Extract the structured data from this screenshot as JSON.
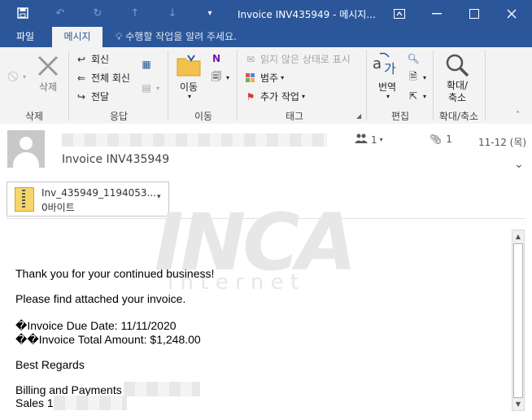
{
  "titlebar": {
    "title": "Invoice INV435949 - 메시지...",
    "save_icon": "save-icon",
    "undo_icon": "undo-icon",
    "redo_icon": "redo-icon",
    "up_icon": "up-arrow-icon",
    "down_icon": "down-arrow-icon",
    "customize_icon": "customize-toolbar-icon"
  },
  "tabs": {
    "file": "파일",
    "message": "메시지",
    "tell_me": "수행할 작업을 알려 주세요."
  },
  "ribbon": {
    "delete_group": {
      "label": "삭제",
      "delete": "삭제"
    },
    "respond_group": {
      "label": "응답",
      "reply": "회신",
      "reply_all": "전체 회신",
      "forward": "전달"
    },
    "move_group": {
      "label": "이동",
      "move": "이동"
    },
    "tags_group": {
      "label": "태그",
      "mark_unread": "읽지 않은 상태로 표시",
      "categorize": "범주",
      "follow_up": "추가 작업"
    },
    "editing_group": {
      "label": "편집",
      "translate": "번역"
    },
    "zoom_group": {
      "label": "확대/축소",
      "zoom": "확대/\n축소"
    }
  },
  "header": {
    "subject": "Invoice INV435949",
    "people_count": "1",
    "attachment_count": "1",
    "date": "11-12 (목)"
  },
  "attachment": {
    "name": "Inv_435949_1194053...",
    "size": "0바이트"
  },
  "watermark": {
    "brand": "INCA",
    "tagline": "i n t e r n e t"
  },
  "body": {
    "line1": "Thank you for your continued business!",
    "line2": "Please find attached your invoice.",
    "line3": "�Invoice Due Date: 11/11/2020",
    "line4": "��Invoice Total Amount: $1,248.00",
    "line5": "Best Regards",
    "line6": "Billing and Payments",
    "line7": "Sales 1"
  },
  "colors": {
    "accent": "#2b579a",
    "ribbon_bg": "#f3f3f3"
  }
}
